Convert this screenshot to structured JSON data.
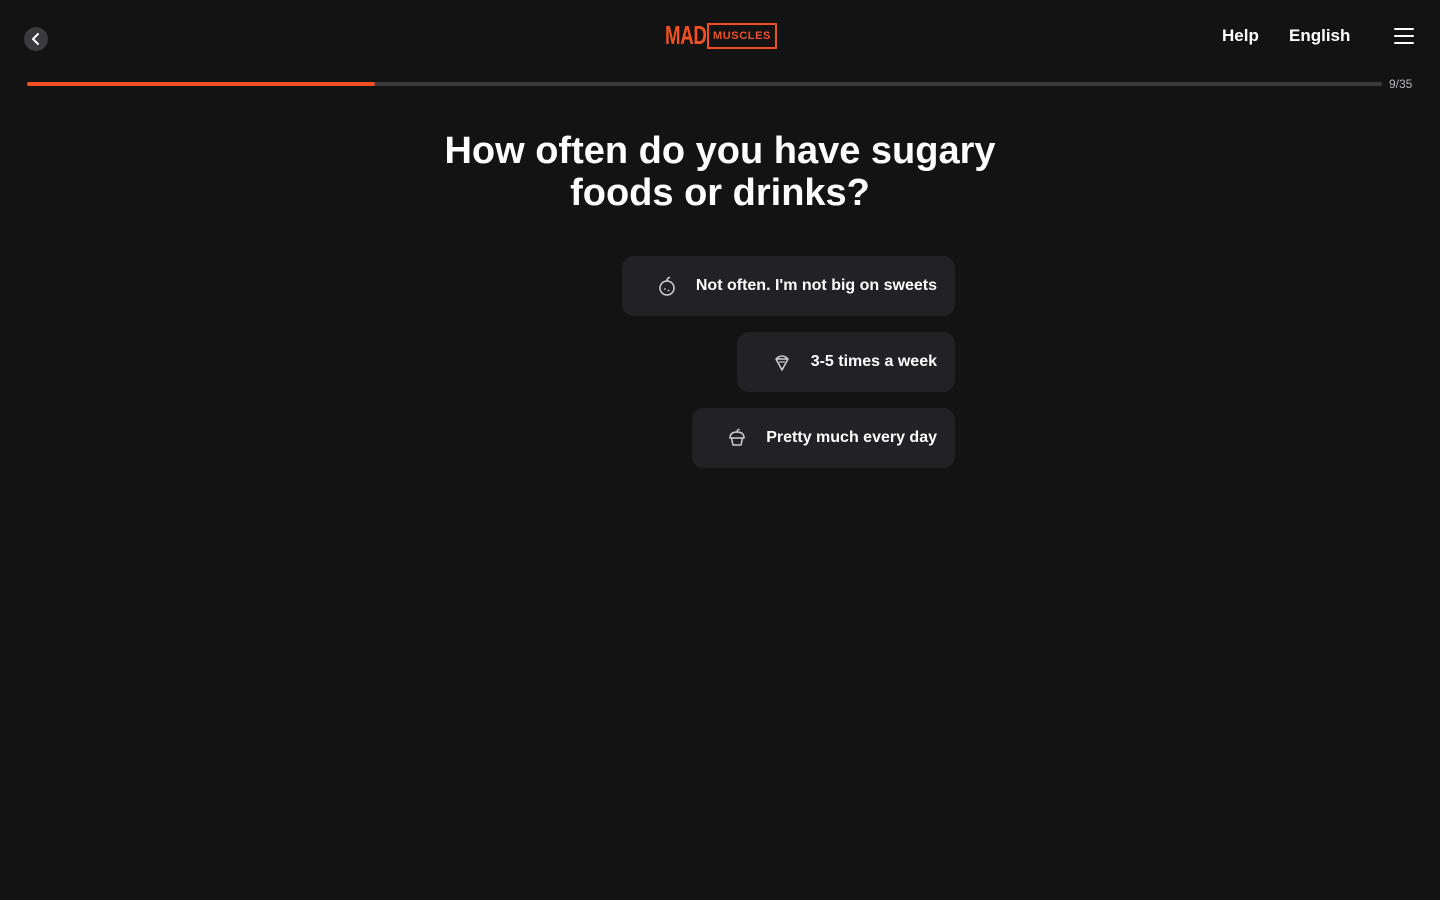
{
  "header": {
    "logo_word": "MAD",
    "logo_box": "MUSCLES",
    "help_label": "Help",
    "language_label": "English"
  },
  "progress": {
    "current": 9,
    "total": 35,
    "fraction": 0.257,
    "label": "9/35",
    "accent": "#f25022"
  },
  "question": {
    "title": "How often do you have sugary foods or drinks?"
  },
  "options": [
    {
      "label": "Not often. I'm not big on sweets",
      "icon": "apple-icon"
    },
    {
      "label": "3-5 times a week",
      "icon": "ice-cream-icon"
    },
    {
      "label": "Pretty much every day",
      "icon": "cupcake-icon"
    }
  ]
}
